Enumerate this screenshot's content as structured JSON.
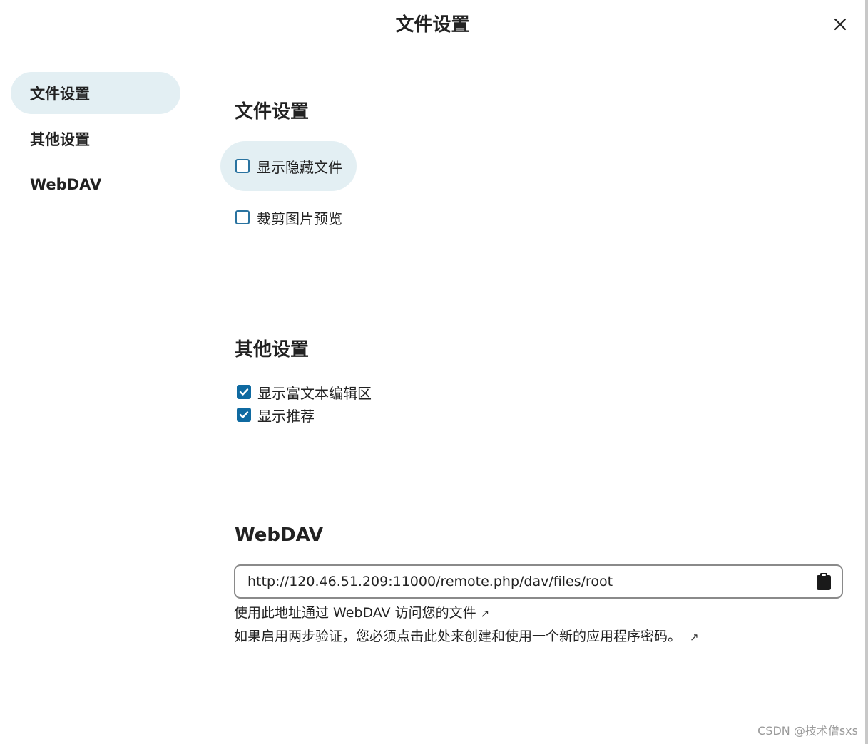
{
  "dialog": {
    "title": "文件设置",
    "close_icon": "close-icon"
  },
  "sidebar": {
    "items": [
      {
        "label": "文件设置",
        "active": true
      },
      {
        "label": "其他设置",
        "active": false
      },
      {
        "label": "WebDAV",
        "active": false
      }
    ]
  },
  "file_settings": {
    "title": "文件设置",
    "options": [
      {
        "label": "显示隐藏文件",
        "checked": false
      },
      {
        "label": "裁剪图片预览",
        "checked": false
      }
    ]
  },
  "other_settings": {
    "title": "其他设置",
    "options": [
      {
        "label": "显示富文本编辑区",
        "checked": true
      },
      {
        "label": "显示推荐",
        "checked": true
      }
    ]
  },
  "webdav": {
    "title": "WebDAV",
    "url": "http://120.46.51.209:11000/remote.php/dav/files/root",
    "copy_icon": "clipboard-icon",
    "help_link": "使用此地址通过 WebDAV 访问您的文件",
    "two_factor_note": "如果启用两步验证，您必须点击此处来创建和使用一个新的应用程序密码。",
    "external_icon": "↗"
  },
  "watermark": "CSDN @技术僧sxs",
  "colors": {
    "accent": "#0f6aa1",
    "active_bg": "#e3eff3"
  }
}
